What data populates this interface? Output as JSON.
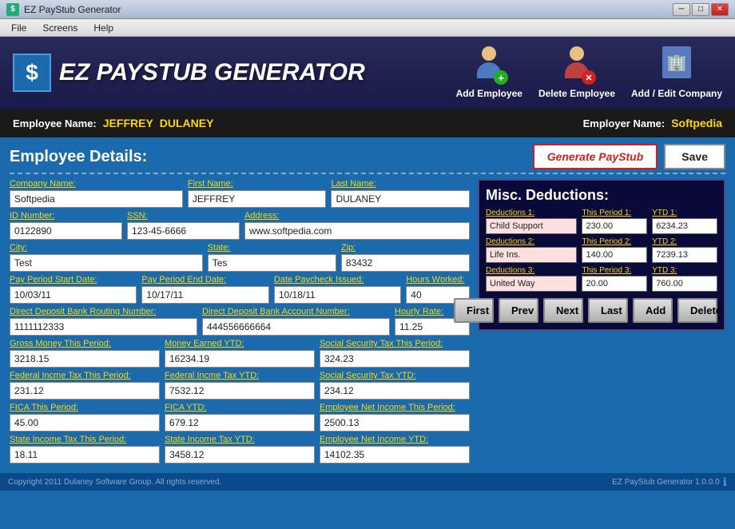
{
  "titlebar": {
    "title": "EZ PayStub Generator",
    "icon": "$",
    "min_btn": "─",
    "max_btn": "□",
    "close_btn": "✕"
  },
  "menubar": {
    "items": [
      "File",
      "Screens",
      "Help"
    ]
  },
  "header": {
    "logo_dollar": "$",
    "logo_text": "EZ PAYSTUB GENERATOR",
    "actions": [
      {
        "label": "Add Employee",
        "badge": "+",
        "badge_type": "green"
      },
      {
        "label": "Delete Employee",
        "badge": "✕",
        "badge_type": "red"
      },
      {
        "label": "Add / Edit Company",
        "badge": "▦",
        "badge_type": "blue"
      }
    ]
  },
  "emp_bar": {
    "name_label": "Employee Name:",
    "first_name": "JEFFREY",
    "last_name": "DULANEY",
    "employer_label": "Employer Name:",
    "employer_name": "Softpedia"
  },
  "section": {
    "title": "Employee Details:",
    "generate_btn": "Generate PayStub",
    "save_btn": "Save"
  },
  "form": {
    "company_label": "Company Name:",
    "company_value": "Softpedia",
    "first_name_label": "First Name:",
    "first_name_value": "JEFFREY",
    "last_name_label": "Last Name:",
    "last_name_value": "DULANEY",
    "id_label": "ID Number:",
    "id_value": "0122890",
    "ssn_label": "SSN:",
    "ssn_value": "123-45-6666",
    "address_label": "Address:",
    "address_value": "www.softpedia.com",
    "city_label": "City:",
    "city_value": "Test",
    "state_label": "State:",
    "state_value": "Tes",
    "zip_label": "Zip:",
    "zip_value": "83432",
    "pay_start_label": "Pay Period Start Date:",
    "pay_start_value": "10/03/11",
    "pay_end_label": "Pay Period End Date:",
    "pay_end_value": "10/17/11",
    "check_date_label": "Date Paycheck Issued:",
    "check_date_value": "10/18/11",
    "hours_label": "Hours Worked:",
    "hours_value": "40",
    "routing_label": "Direct Deposit Bank Routing Number:",
    "routing_value": "1111112333",
    "account_label": "Direct Deposit Bank Account Number:",
    "account_value": "444556666664",
    "hourly_label": "Hourly Rate:",
    "hourly_value": "11.25",
    "gross_label": "Gross Money This Period:",
    "gross_value": "3218.15",
    "ytd_label": "Money Earned YTD:",
    "ytd_value": "16234.19",
    "ss_tax_label": "Social Security Tax This Period:",
    "ss_tax_value": "324.23",
    "fed_tax_label": "Federal Incme Tax This Period:",
    "fed_tax_value": "231.12",
    "fed_ytd_label": "Federal Incme Tax YTD:",
    "fed_ytd_value": "7532.12",
    "ss_ytd_label": "Social Security Tax YTD:",
    "ss_ytd_value": "234.12",
    "fica_label": "FICA This Period:",
    "fica_value": "45.00",
    "fica_ytd_label": "FICA YTD:",
    "fica_ytd_value": "679.12",
    "net_label": "Employee Net Income This Period:",
    "net_value": "2500.13",
    "state_tax_label": "State Income Tax This Period:",
    "state_tax_value": "18.11",
    "state_ytd_label": "State Income Tax YTD:",
    "state_ytd_value": "3458.12",
    "net_ytd_label": "Employee Net Income YTD:",
    "net_ytd_value": "14102.35"
  },
  "deductions": {
    "title": "Misc. Deductions:",
    "ded1_label": "Deductions 1:",
    "ded1_value": "Child Support",
    "period1_label": "This Period 1:",
    "period1_value": "230.00",
    "ytd1_label": "YTD 1:",
    "ytd1_value": "6234.23",
    "ded2_label": "Deductions 2:",
    "ded2_value": "Life Ins.",
    "period2_label": "This Period 2:",
    "period2_value": "140.00",
    "ytd2_label": "YTD 2:",
    "ytd2_value": "7239.13",
    "ded3_label": "Deductions 3:",
    "ded3_value": "United Way",
    "period3_label": "This Period 3:",
    "period3_value": "20.00",
    "ytd3_label": "YTD 3:",
    "ytd3_value": "760.00"
  },
  "nav": {
    "first": "First",
    "prev": "Prev",
    "next": "Next",
    "last": "Last",
    "add": "Add",
    "delete": "Delete"
  },
  "footer": {
    "copyright": "Copyright 2011 Dulaney Software Group. All rights reserved.",
    "version": "EZ PayStub Generator 1.0.0.0",
    "info_icon": "ℹ"
  }
}
